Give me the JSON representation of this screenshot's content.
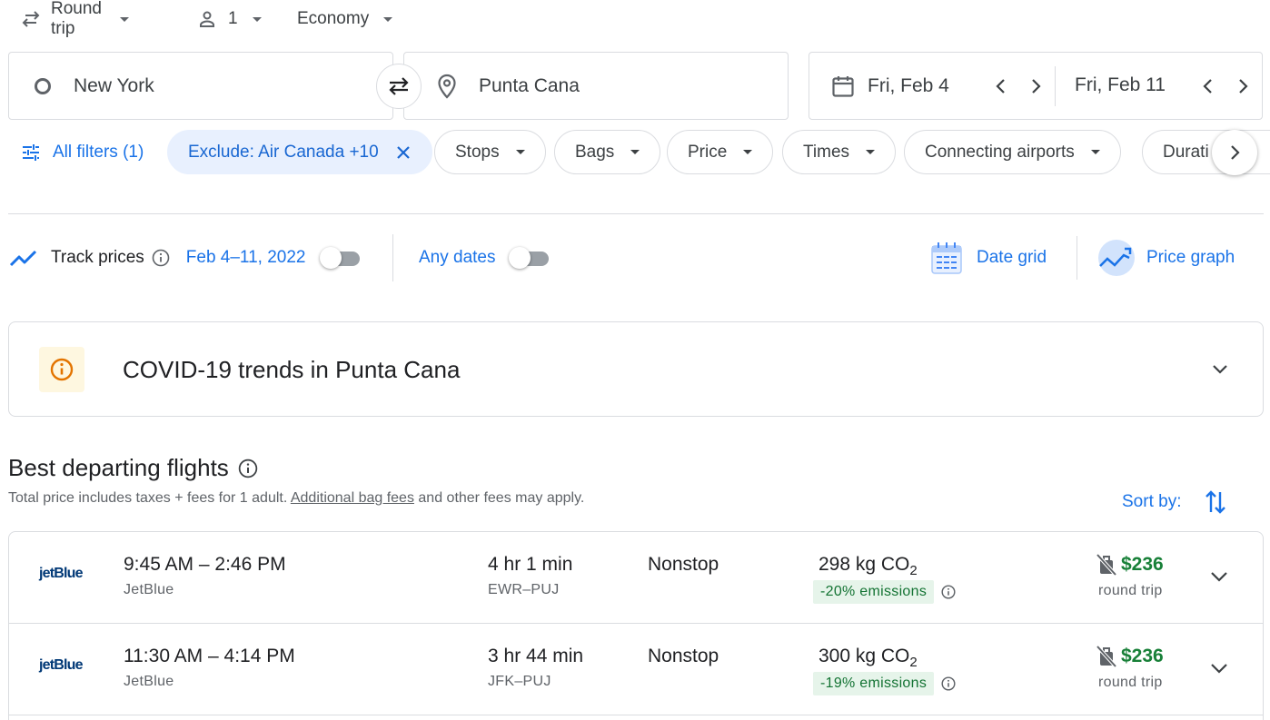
{
  "top": {
    "trip_type": "Round trip",
    "passengers": "1",
    "cabin_class": "Economy"
  },
  "search": {
    "origin": "New York",
    "destination": "Punta Cana",
    "depart_date": "Fri, Feb 4",
    "return_date": "Fri, Feb 11"
  },
  "filters": {
    "all_filters": "All filters (1)",
    "exclude_chip": "Exclude: Air Canada +10",
    "chips": [
      "Stops",
      "Bags",
      "Price",
      "Times",
      "Connecting airports",
      "Durati"
    ]
  },
  "track": {
    "label": "Track prices",
    "dates": "Feb 4–11, 2022",
    "any_dates": "Any dates",
    "date_grid": "Date grid",
    "price_graph": "Price graph"
  },
  "covid": {
    "title": "COVID-19 trends in Punta Cana"
  },
  "best": {
    "title": "Best departing flights",
    "subtitle_prefix": "Total price includes taxes + fees for 1 adult. ",
    "subtitle_link": "Additional bag fees",
    "subtitle_suffix": " and other fees may apply.",
    "sort_by": "Sort by:"
  },
  "flights": [
    {
      "logo": "jetBlue",
      "times": "9:45 AM – 2:46 PM",
      "airline": "JetBlue",
      "duration": "4 hr 1 min",
      "route": "EWR–PUJ",
      "stops": "Nonstop",
      "co2": "298 kg CO",
      "co2_sub": "2",
      "emissions": "-20% emissions",
      "price": "$236",
      "price_note": "round trip"
    },
    {
      "logo": "jetBlue",
      "times": "11:30 AM – 4:14 PM",
      "airline": "JetBlue",
      "duration": "3 hr 44 min",
      "route": "JFK–PUJ",
      "stops": "Nonstop",
      "co2": "300 kg CO",
      "co2_sub": "2",
      "emissions": "-19% emissions",
      "price": "$236",
      "price_note": "round trip"
    }
  ],
  "colors": {
    "accent": "#1a73e8",
    "price_green": "#188038",
    "emissions_bg": "#e6f4ea",
    "chip_selected_bg": "#e8f0fe"
  }
}
